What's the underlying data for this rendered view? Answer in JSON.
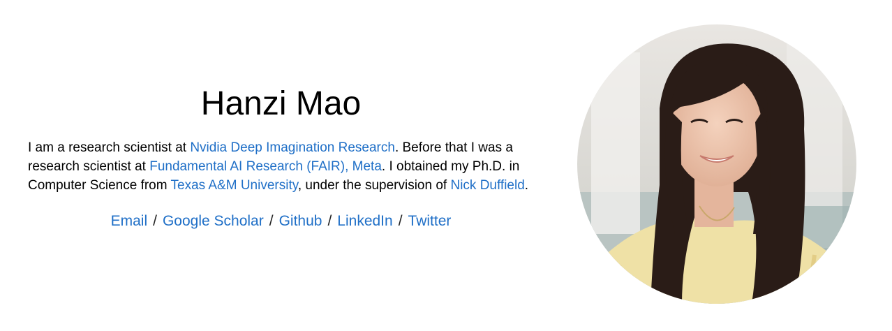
{
  "profile": {
    "name": "Hanzi Mao",
    "bio": {
      "p1": "I am a research scientist at ",
      "link1": "Nvidia Deep Imagination Research",
      "p2": ". Before that I was a research scientist at ",
      "link2": "Fundamental AI Research (FAIR), Meta",
      "p3": ". I obtained my Ph.D. in Computer Science from ",
      "link3": "Texas A&M University",
      "p4": ", under the supervision of ",
      "link4": "Nick Duffield",
      "p5": "."
    },
    "links": {
      "email": "Email",
      "scholar": "Google Scholar",
      "github": "Github",
      "linkedin": "LinkedIn",
      "twitter": "Twitter",
      "separator": "/"
    },
    "photo_icon": "profile-photo"
  },
  "colors": {
    "link": "#1f6fc7",
    "text": "#000000",
    "background": "#ffffff"
  }
}
